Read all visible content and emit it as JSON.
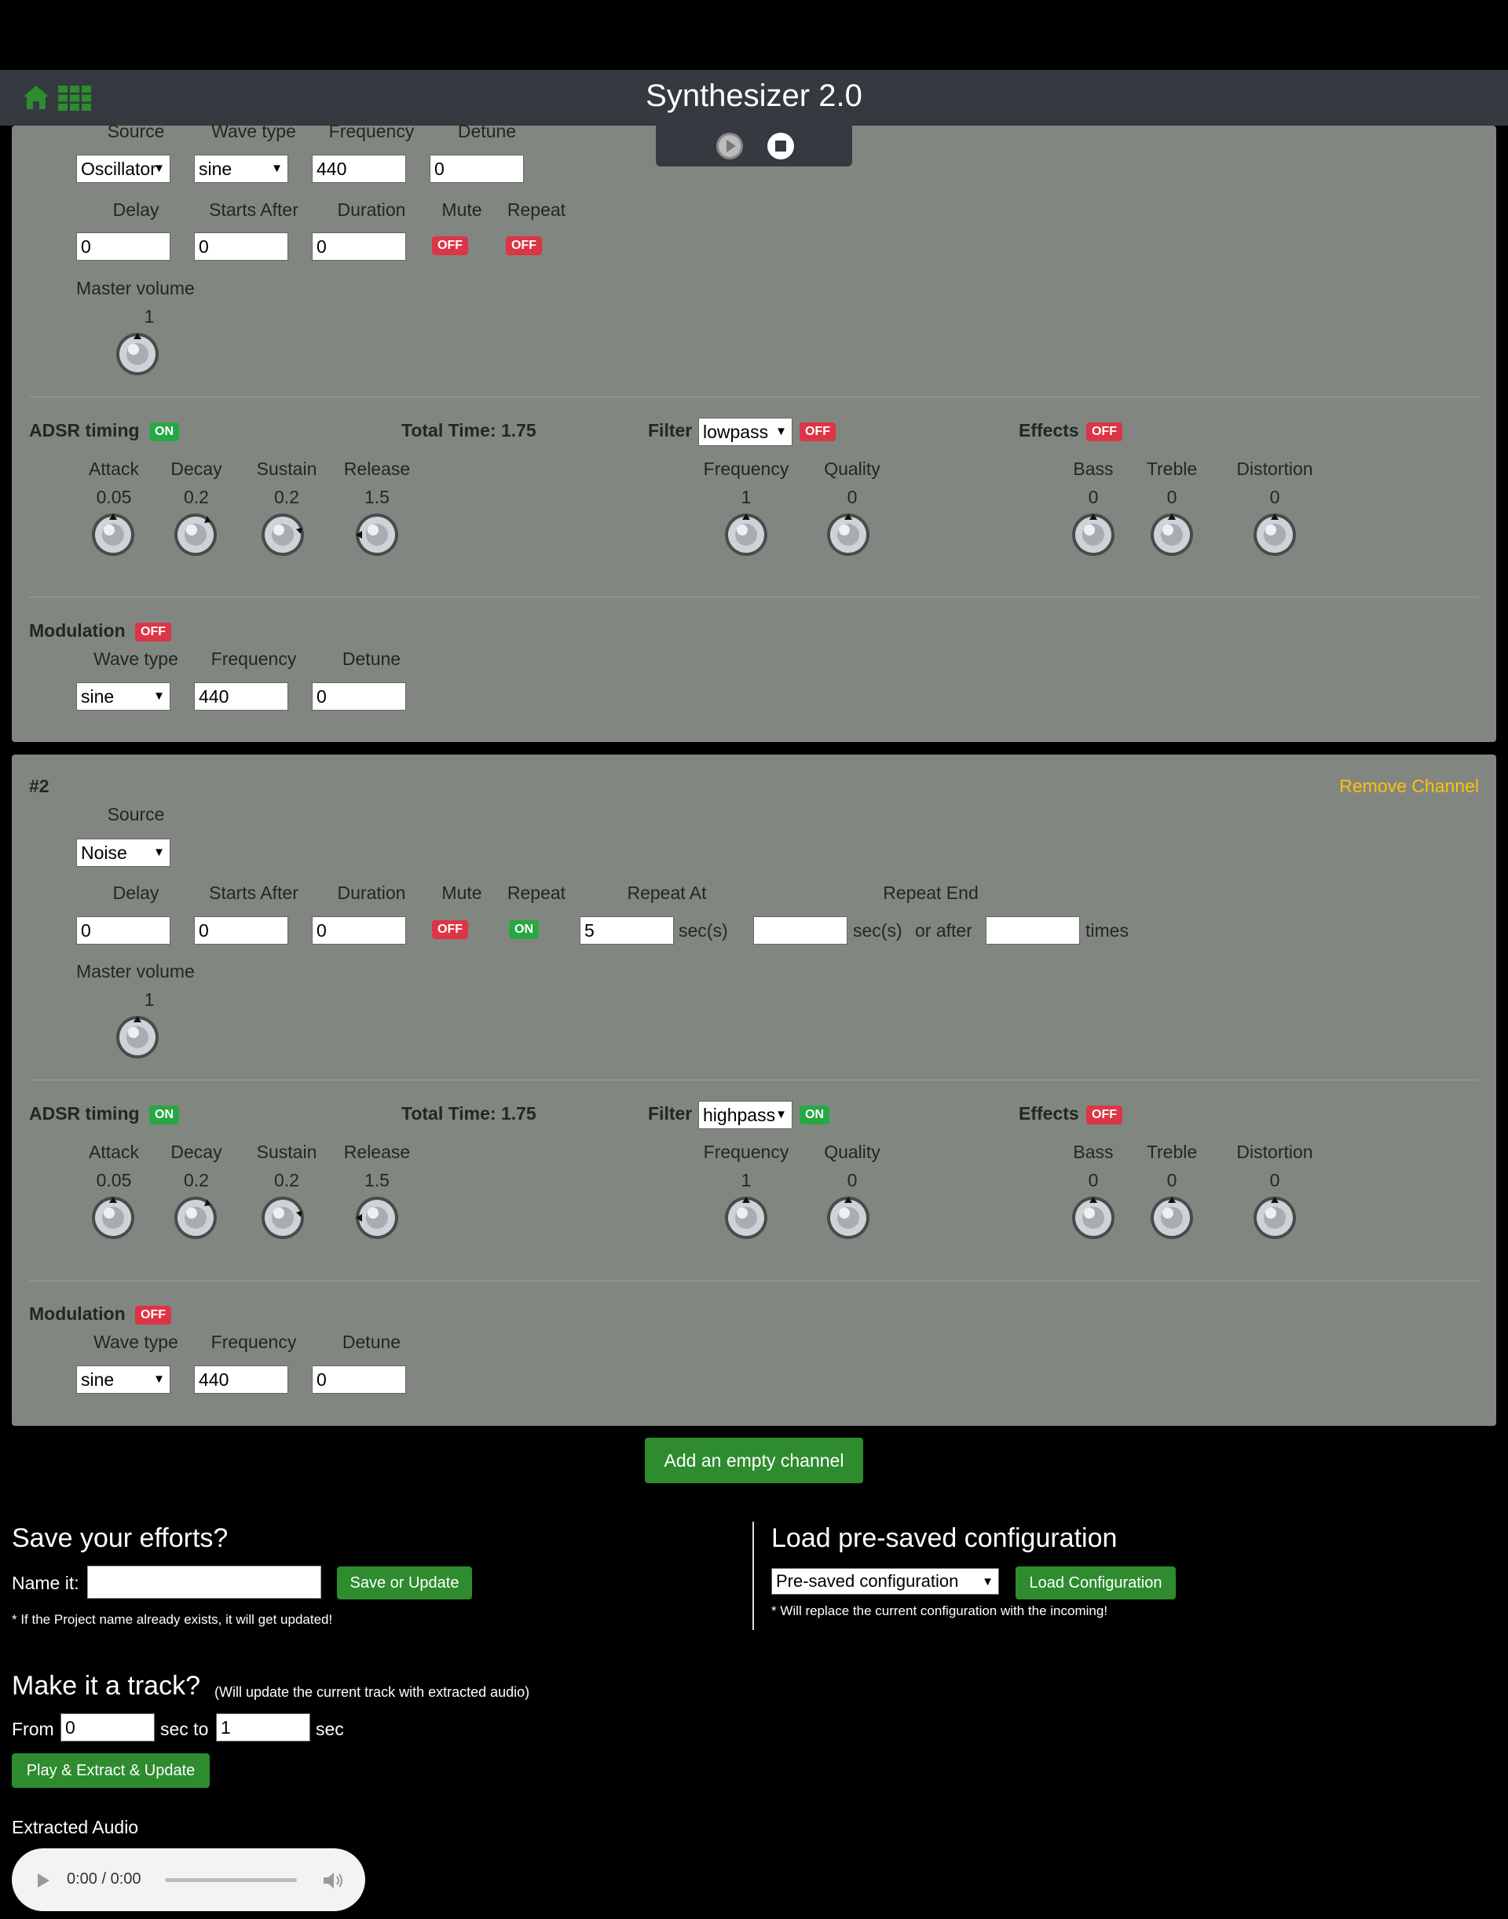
{
  "header": {
    "title": "Synthesizer 2.0",
    "home_icon": "home-icon",
    "apps_icon": "grid-icon",
    "accent": "#2e8b2e",
    "bar_color": "#343a40"
  },
  "transport": {
    "play_icon": "play-icon",
    "stop_icon": "stop-icon"
  },
  "channel1": {
    "source_label": "Source",
    "source_value": "Oscillator",
    "wave_label": "Wave type",
    "wave_value": "sine",
    "freq_label": "Frequency",
    "freq_value": "440",
    "detune_label": "Detune",
    "detune_value": "0",
    "delay_label": "Delay",
    "delay_value": "0",
    "starts_label": "Starts After",
    "starts_value": "0",
    "duration_label": "Duration",
    "duration_value": "0",
    "mute_label": "Mute",
    "mute_state": "OFF",
    "repeat_label": "Repeat",
    "repeat_state": "OFF",
    "master_label": "Master volume",
    "master_value": "1",
    "adsr": {
      "label": "ADSR timing",
      "state": "ON",
      "total": "Total Time: 1.75",
      "attack_label": "Attack",
      "attack": "0.05",
      "decay_label": "Decay",
      "decay": "0.2",
      "sustain_label": "Sustain",
      "sustain": "0.2",
      "release_label": "Release",
      "release": "1.5"
    },
    "filter": {
      "label": "Filter",
      "type": "lowpass",
      "state": "OFF",
      "freq_label": "Frequency",
      "freq": "1",
      "quality_label": "Quality",
      "quality": "0"
    },
    "effects": {
      "label": "Effects",
      "state": "OFF",
      "bass_label": "Bass",
      "bass": "0",
      "treble_label": "Treble",
      "treble": "0",
      "dist_label": "Distortion",
      "dist": "0"
    },
    "modulation": {
      "label": "Modulation",
      "state": "OFF",
      "wave_label": "Wave type",
      "wave": "sine",
      "freq_label": "Frequency",
      "freq": "440",
      "detune_label": "Detune",
      "detune": "0"
    }
  },
  "channel2": {
    "number": "#2",
    "remove_label": "Remove Channel",
    "source_label": "Source",
    "source_value": "Noise",
    "delay_label": "Delay",
    "delay_value": "0",
    "starts_label": "Starts After",
    "starts_value": "0",
    "duration_label": "Duration",
    "duration_value": "0",
    "mute_label": "Mute",
    "mute_state": "OFF",
    "repeat_label": "Repeat",
    "repeat_state": "ON",
    "repeat_at_label": "Repeat At",
    "repeat_at_value": "5",
    "secs": "sec(s)",
    "repeat_end_label": "Repeat End",
    "repeat_end_value": "",
    "or_after": "or after",
    "times_value": "",
    "times": "times",
    "master_label": "Master volume",
    "master_value": "1",
    "adsr": {
      "label": "ADSR timing",
      "state": "ON",
      "total": "Total Time: 1.75",
      "attack_label": "Attack",
      "attack": "0.05",
      "decay_label": "Decay",
      "decay": "0.2",
      "sustain_label": "Sustain",
      "sustain": "0.2",
      "release_label": "Release",
      "release": "1.5"
    },
    "filter": {
      "label": "Filter",
      "type": "highpass",
      "state": "ON",
      "freq_label": "Frequency",
      "freq": "1",
      "quality_label": "Quality",
      "quality": "0"
    },
    "effects": {
      "label": "Effects",
      "state": "OFF",
      "bass_label": "Bass",
      "bass": "0",
      "treble_label": "Treble",
      "treble": "0",
      "dist_label": "Distortion",
      "dist": "0"
    },
    "modulation": {
      "label": "Modulation",
      "state": "OFF",
      "wave_label": "Wave type",
      "wave": "sine",
      "freq_label": "Frequency",
      "freq": "440",
      "detune_label": "Detune",
      "detune": "0"
    }
  },
  "add_channel_label": "Add an empty channel",
  "save": {
    "title": "Save your efforts?",
    "name_label": "Name it:",
    "name_value": "",
    "button": "Save or Update",
    "note": "* If the Project name already exists, it will get updated!"
  },
  "load": {
    "title": "Load pre-saved configuration",
    "select_value": "Pre-saved configuration",
    "button": "Load Configuration",
    "note": "* Will replace the current configuration with the incoming!"
  },
  "track": {
    "title": "Make it a track?",
    "subtitle": "(Will update the current track with extracted audio)",
    "from_label": "From",
    "from_value": "0",
    "sec_to": "sec to",
    "to_value": "1",
    "sec": "sec",
    "button": "Play & Extract & Update",
    "extracted_label": "Extracted Audio",
    "time_display": "0:00 / 0:00"
  }
}
